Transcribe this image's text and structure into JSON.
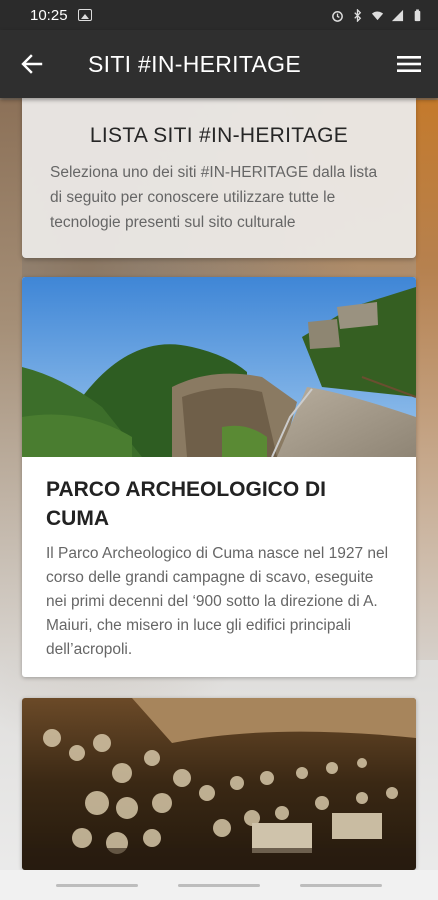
{
  "statusbar": {
    "time": "10:25",
    "icons": [
      "image-icon",
      "alarm-icon",
      "bluetooth-icon",
      "wifi-icon",
      "signal-icon",
      "battery-icon"
    ]
  },
  "appbar": {
    "title": "SITI #IN-HERITAGE",
    "back_icon": "arrow-left-icon",
    "menu_icon": "hamburger-icon"
  },
  "intro": {
    "title": "LISTA SITI #IN-HERITAGE",
    "text": "Seleziona uno dei siti #IN-HERITAGE dalla lista di seguito per conoscere utilizzare tutte le tecnologie presenti sul sito culturale"
  },
  "sites": [
    {
      "title": "PARCO ARCHEOLOGICO DI CUMA",
      "description": "Il Parco Archeologico di Cuma nasce nel 1927 nel corso delle grandi campagne di scavo, eseguite nei primi decenni del ‘900 sotto la direzione di A. Maiuri, che misero in luce gli edifici principali dell’acropoli."
    },
    {
      "title": "",
      "description": ""
    }
  ],
  "colors": {
    "appbar": "#2f2f2f",
    "statusbar": "#2b2b2b",
    "card": "#ffffff",
    "text_muted": "#666666"
  }
}
